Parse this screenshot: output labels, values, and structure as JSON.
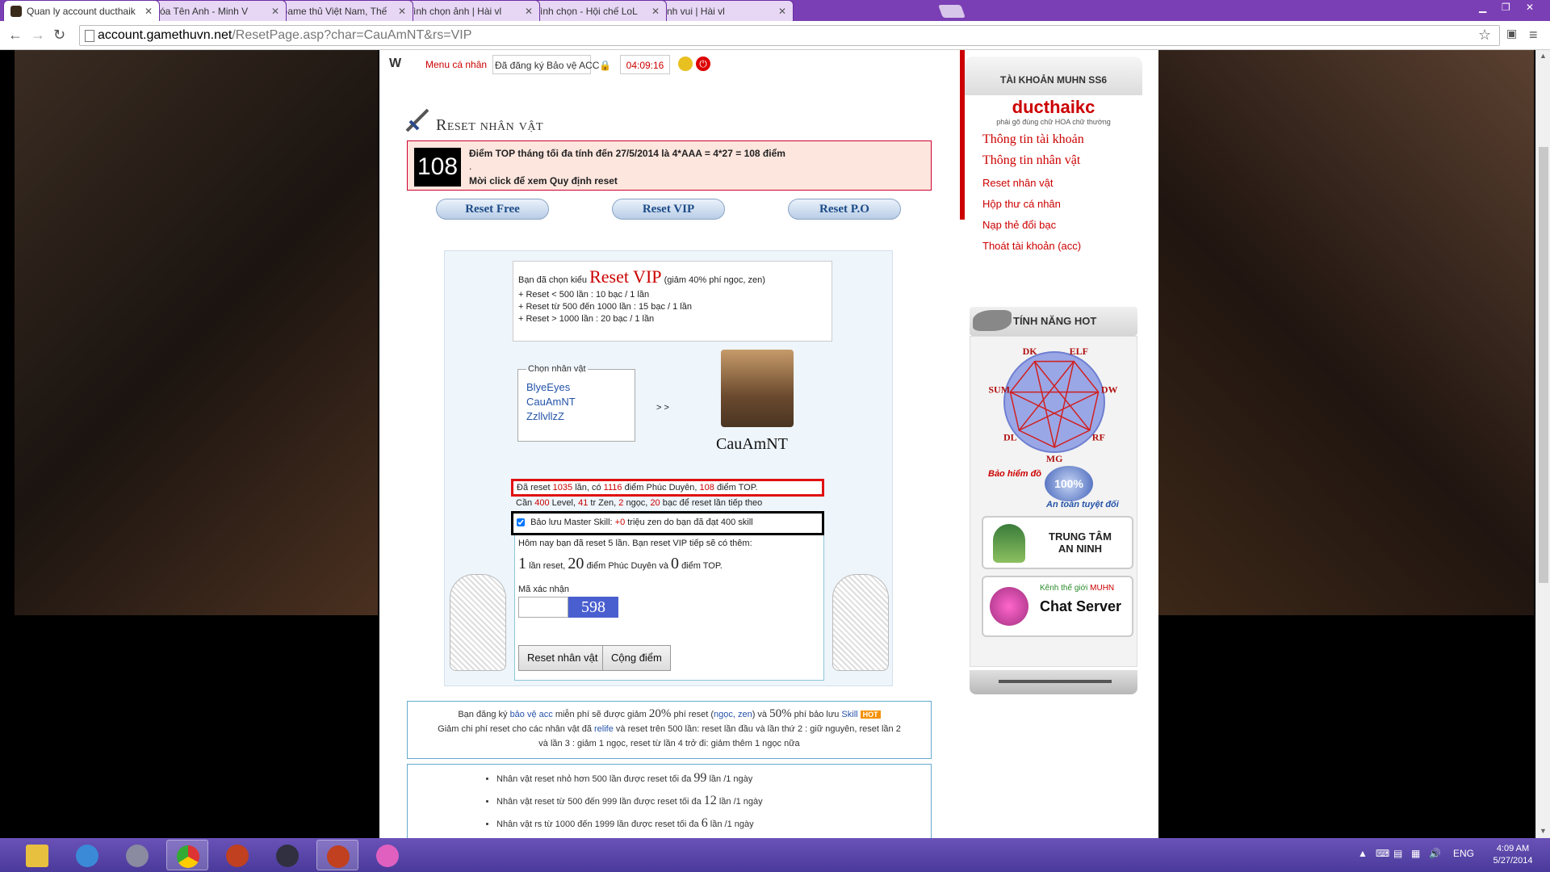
{
  "browser": {
    "tabs": [
      {
        "label": "Quan ly account ducthaik",
        "color": "#3a2a1a",
        "active": true
      },
      {
        "label": "Xóa Tên Anh - Minh V",
        "color": "#c03030",
        "active": false
      },
      {
        "label": "Game thủ Việt Nam, Thế",
        "color": "#3a6ac0",
        "active": false
      },
      {
        "label": "Bình chọn ảnh | Hài vl",
        "color": "#c03a90",
        "active": false
      },
      {
        "label": "Bình chọn - Hội chế LoL",
        "color": "#3aa03a",
        "active": false
      },
      {
        "label": "Ảnh vui | Hài vl",
        "color": "#c03a90",
        "active": false
      }
    ],
    "url_host": "account.gamethuvn.net",
    "url_path": "/ResetPage.asp?char=CauAmNT&rs=VIP"
  },
  "topbar": {
    "logo": "W",
    "menu_label": "Menu cá nhân",
    "register_text": "Đã đăng ký Bảo vệ ACC",
    "time": "04:09:16"
  },
  "header": {
    "title": "Reset nhân vật"
  },
  "notice": {
    "number": "108",
    "line1": "Điểm TOP tháng tối đa tính đến 27/5/2014 là 4*AAA = 4*27 = 108 điểm",
    "line2": ".",
    "line3": "Mời click để xem Quy định reset"
  },
  "reset_buttons": [
    {
      "label": "Reset Free"
    },
    {
      "label": "Reset VIP"
    },
    {
      "label": "Reset P.O"
    }
  ],
  "choice": {
    "prefix": "Bạn đã chọn kiểu",
    "type": "Reset VIP",
    "suffix": "(giảm 40% phí ngọc, zen)",
    "rules": [
      "+ Reset < 500 lần : 10 bạc / 1 lần",
      "+ Reset từ 500 đến 1000 lần : 15 bạc / 1 lần",
      "+ Reset > 1000 lần : 20 bạc / 1 lần"
    ]
  },
  "character_select": {
    "legend": "Chọn nhân vật",
    "characters": [
      "BlyeEyes",
      "CauAmNT",
      "ZzllvllzZ"
    ],
    "arrow": "> >",
    "selected_name": "CauAmNT"
  },
  "stats": {
    "p1": "Đã reset",
    "reset_count": "1035",
    "p2": "lần, có",
    "phuc_duyen": "1116",
    "p3": "điểm Phúc Duyên,",
    "top_points": "108",
    "p4": "điểm TOP.",
    "n1": "Cần",
    "level": "400",
    "n2": "Level,",
    "zen": "41",
    "n3": "tr Zen,",
    "ngoc": "2",
    "n4": "ngọc,",
    "bac": "20",
    "n5": "bạc để reset lần tiếp theo"
  },
  "skill": {
    "p1": "Bảo lưu Master Skill:",
    "value": "+0",
    "p2": "triệu zen do bạn đã đạt 400 skill"
  },
  "today": {
    "line1": "Hôm nay bạn đã reset 5 lần. Bạn reset VIP tiếp sẽ có thêm:",
    "reset_n": "1",
    "reset_label": "lần reset,",
    "pd_n": "20",
    "pd_label": "điểm Phúc Duyên và",
    "top_n": "0",
    "top_label": "điểm TOP.",
    "captcha_label": "Mã xác nhận",
    "captcha_code": "598",
    "reset_button": "Reset nhân vật",
    "add_points_button": "Cộng điểm"
  },
  "promo": {
    "a1": "Bạn đăng ký",
    "a2": "bảo vệ acc",
    "a3": "miễn phí sẽ được giảm",
    "pct1": "20%",
    "a4": "phí reset (",
    "a5": "ngọc, zen",
    "a6": ") và",
    "pct2": "50%",
    "a7": "phí bảo lưu",
    "a8": "Skill",
    "hot": "HOT",
    "b1": "Giảm chi phí reset cho các nhân vật đã",
    "b2": "relife",
    "b3": "và reset trên 500 lần: reset lần đầu và lần thứ 2 : giữ nguyên, reset lần 2",
    "b4": "và lần 3 : giảm 1 ngọc, reset từ lần 4 trở đi: giảm thêm 1 ngọc nữa"
  },
  "limits": [
    {
      "pre": "Nhân vật reset nhỏ hơn 500 lần được reset tối đa",
      "n": "99",
      "post": "lần /1 ngày"
    },
    {
      "pre": "Nhân vật reset từ 500 đến 999 lần được reset tối đa",
      "n": "12",
      "post": "lần /1 ngày"
    },
    {
      "pre": "Nhân vật rs từ 1000 đến 1999 lần được reset tối đa",
      "n": "6",
      "post": "lần /1 ngày"
    }
  ],
  "sidebar": {
    "heading": "TÀI KHOẢN MUHN SS6",
    "username": "ducthaikc",
    "hint": "phải gõ đúng chữ HOA chữ thường",
    "links": [
      {
        "label": "Thông tin tài khoản",
        "style": "serif"
      },
      {
        "label": "Thông tin nhân vật",
        "style": "serif"
      },
      {
        "label": "Reset nhân vật",
        "style": "sans"
      },
      {
        "label": "Hộp thư cá nhân",
        "style": "sans"
      },
      {
        "label": "Nạp thẻ đổi bạc",
        "style": "sans"
      },
      {
        "label": "Thoát tài khoản (acc)",
        "style": "sans"
      }
    ],
    "hot_heading": "TÍNH NĂNG HOT",
    "classes": [
      "DK",
      "ELF",
      "DW",
      "RF",
      "MG",
      "DL",
      "SUM"
    ],
    "insurance_title": "Bảo hiểm đồ",
    "insurance_seal": "100%",
    "insurance_slogan": "An toàn tuyệt đối",
    "security_label_1": "TRUNG TÂM",
    "security_label_2": "AN NINH",
    "chat_kenh": "Kênh thế giới",
    "chat_muhn": "MUHN",
    "chat_label": "Chat Server"
  },
  "taskbar": {
    "lang": "ENG",
    "time": "4:09 AM",
    "date": "5/27/2014"
  }
}
